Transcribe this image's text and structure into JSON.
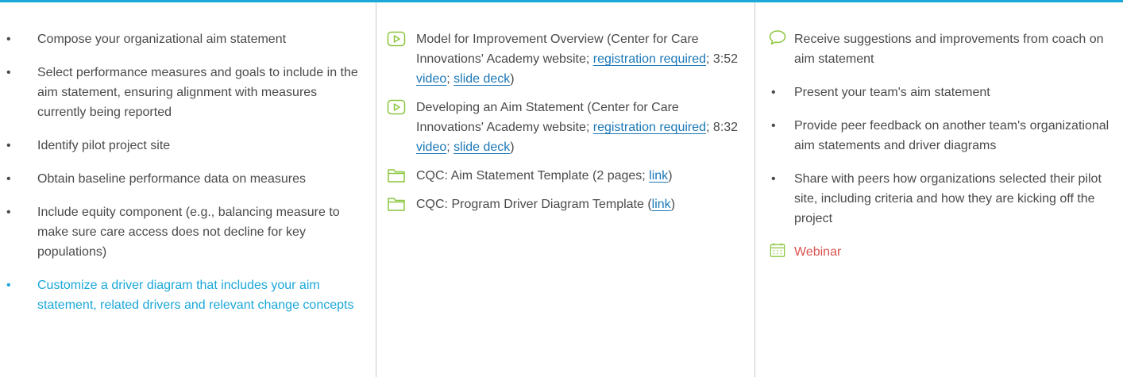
{
  "col1": {
    "items": [
      {
        "text": "Compose your organizational aim statement"
      },
      {
        "text": "Select performance measures and goals to include in the aim statement, ensuring alignment with measures currently being reported"
      },
      {
        "text": "Identify pilot project site"
      },
      {
        "text": "Obtain baseline performance data on measures"
      },
      {
        "text": "Include equity component (e.g., balancing measure to make sure care access does not decline for key populations)"
      },
      {
        "text": "Customize a driver diagram that includes your aim statement, related drivers and relevant change concepts"
      }
    ]
  },
  "col2": {
    "r1": {
      "pre": "Model for Improvement Overview (Center for Care Innovations' Academy website; ",
      "link1": "registration required",
      "sep1": "; 3:52 ",
      "link2": "video",
      "sep2": "; ",
      "link3": "slide deck",
      "post": ")"
    },
    "r2": {
      "pre": "Developing an Aim Statement (Center for Care Innovations' Academy website; ",
      "link1": "registration required",
      "sep1": "; 8:32 ",
      "link2": "video",
      "sep2": "; ",
      "link3": "slide deck",
      "post": ")"
    },
    "r3": {
      "pre": "CQC: Aim Statement Template (2 pages; ",
      "link": "link",
      "post": ")"
    },
    "r4": {
      "pre": "CQC: Program Driver Diagram Template (",
      "link": "link",
      "post": ")"
    }
  },
  "col3": {
    "items": [
      {
        "text": "Receive suggestions and improvements from coach on aim statement"
      },
      {
        "text": "Present your team's aim statement"
      },
      {
        "text": "Provide peer feedback on another team's organizational aim statements and driver diagrams"
      },
      {
        "text": "Share with peers how organizations selected their pilot site, including criteria and how they are kicking off the project"
      },
      {
        "text": "Webinar"
      }
    ]
  },
  "colors": {
    "accent": "#1aa7d9",
    "icon_green": "#8cc63f",
    "link": "#1a78b8",
    "webinar": "#d9534f",
    "text": "#4a4a4a"
  },
  "icons": [
    "video-icon",
    "folder-icon",
    "speech-bubble-icon",
    "calendar-icon"
  ]
}
